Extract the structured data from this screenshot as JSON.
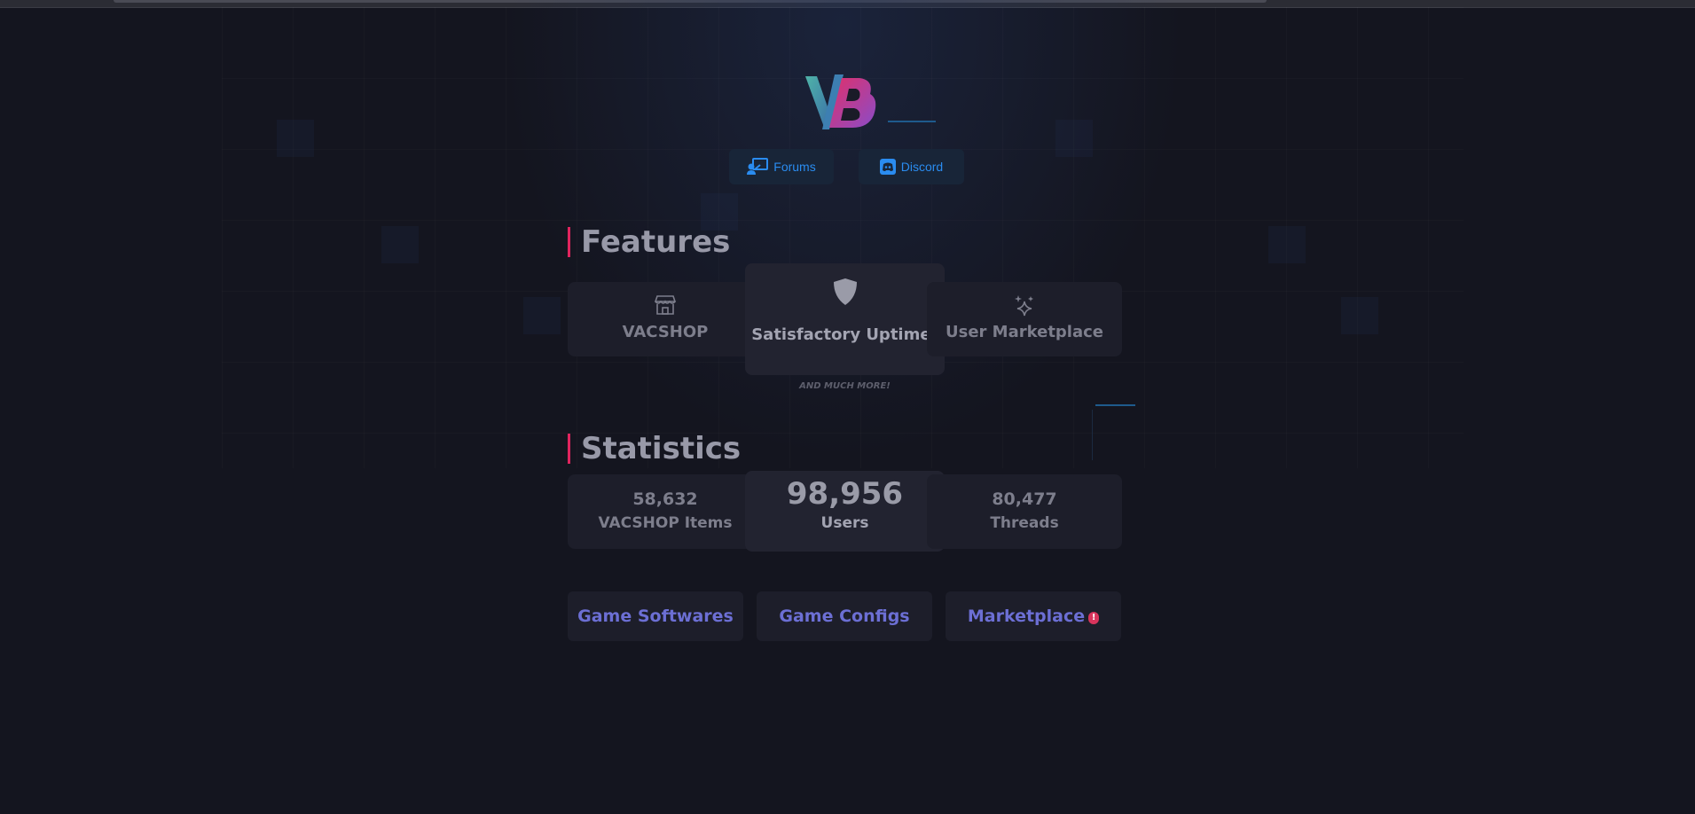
{
  "nav": {
    "forums_label": "Forums",
    "discord_label": "Discord"
  },
  "features": {
    "title": "Features",
    "cards": [
      {
        "label": "VACSHOP",
        "icon": "store-icon"
      },
      {
        "label": "Satisfactory Uptime!",
        "icon": "shield-icon"
      },
      {
        "label": "User Marketplace",
        "icon": "sparkles-icon"
      }
    ],
    "more_label": "AND MUCH MORE!"
  },
  "statistics": {
    "title": "Statistics",
    "items": [
      {
        "value": "58,632",
        "label": "VACSHOP Items"
      },
      {
        "value": "98,956",
        "label": "Users"
      },
      {
        "value": "80,477",
        "label": "Threads"
      }
    ]
  },
  "links": [
    {
      "label": "Game Softwares"
    },
    {
      "label": "Game Configs"
    },
    {
      "label": "Marketplace",
      "badge": "!"
    }
  ],
  "colors": {
    "background": "#14151f",
    "accent": "#e0245e",
    "link": "#6c6fd4",
    "nav_text": "#2a8cf0"
  }
}
